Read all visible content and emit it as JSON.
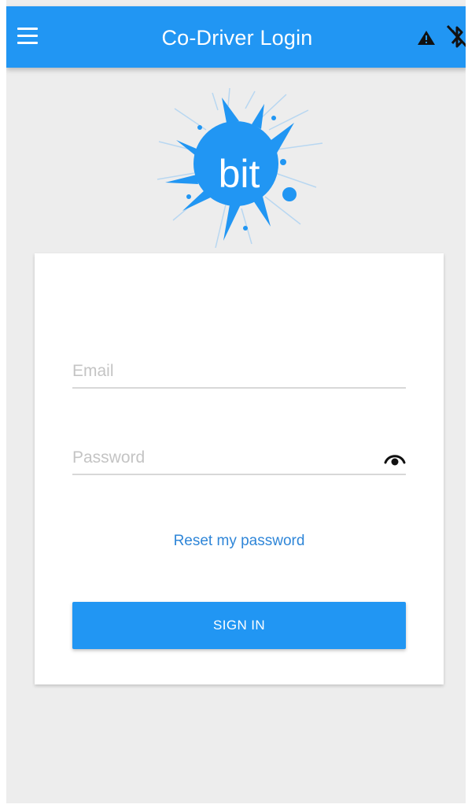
{
  "appbar": {
    "title": "Co-Driver Login",
    "menu_icon": "hamburger-menu-icon",
    "status_icons": [
      "warning-icon",
      "bluetooth-disabled-icon"
    ],
    "color": "#2196f3"
  },
  "logo": {
    "text": "bit",
    "color": "#2196f3"
  },
  "login_form": {
    "email": {
      "value": "",
      "placeholder": "Email"
    },
    "password": {
      "value": "",
      "placeholder": "Password",
      "toggle_icon": "eye-icon"
    },
    "reset_link": "Reset my password",
    "submit_label": "SIGN IN"
  }
}
